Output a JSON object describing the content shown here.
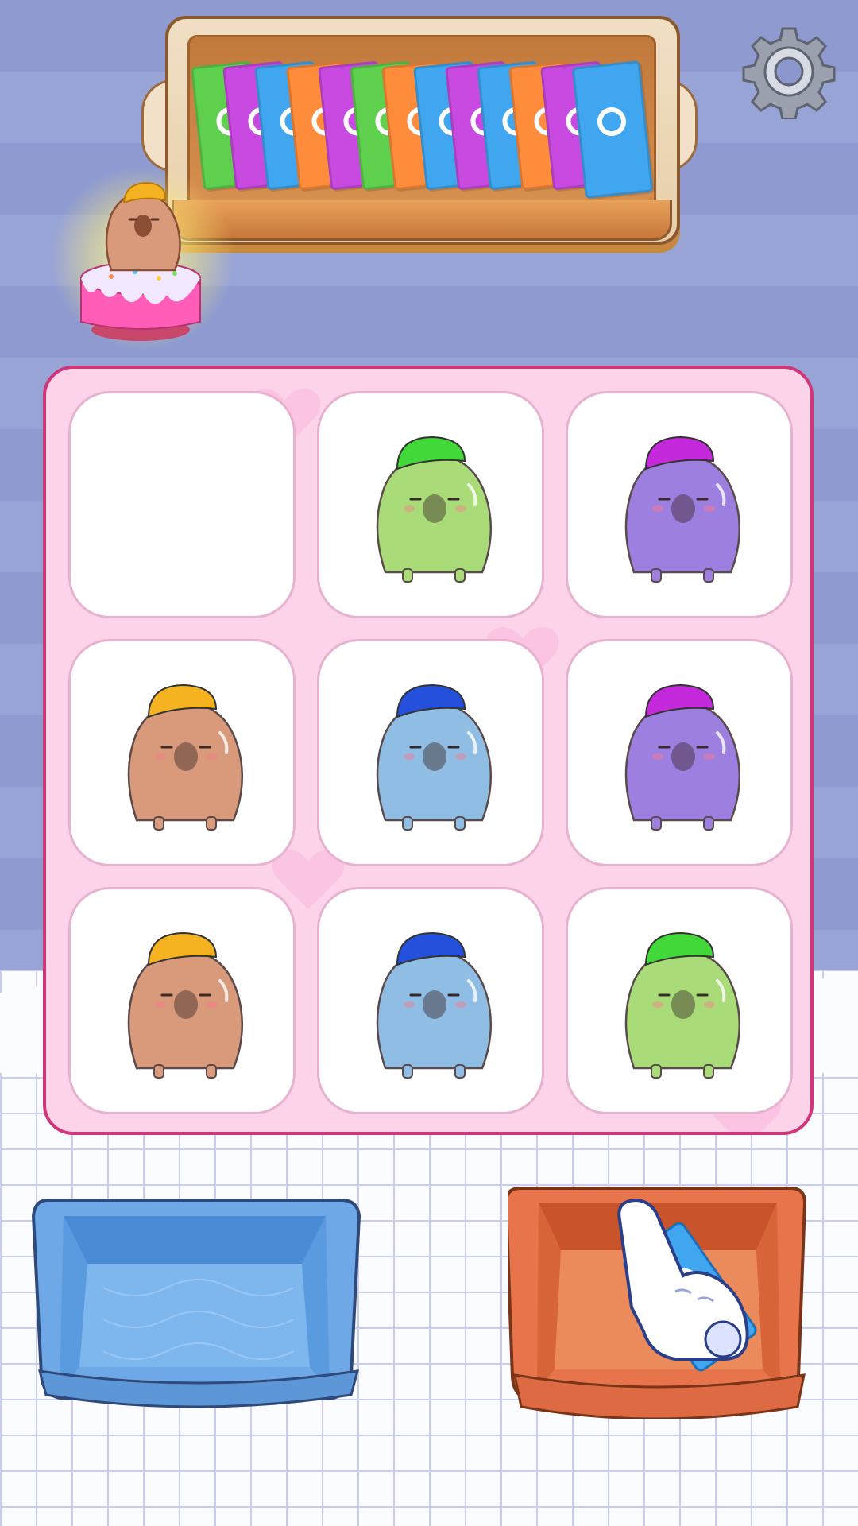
{
  "game": {
    "settings_icon": "gear-icon",
    "tray": {
      "cards": [
        {
          "color": "#5ed04e"
        },
        {
          "color": "#c84ae0"
        },
        {
          "color": "#3fa6ef"
        },
        {
          "color": "#ff8c3a"
        },
        {
          "color": "#c84ae0"
        },
        {
          "color": "#5ed04e"
        },
        {
          "color": "#ff8c3a"
        },
        {
          "color": "#3fa6ef"
        },
        {
          "color": "#c84ae0"
        },
        {
          "color": "#3fa6ef"
        },
        {
          "color": "#ff8c3a"
        },
        {
          "color": "#c84ae0"
        },
        {
          "color": "#3fa6ef"
        }
      ]
    },
    "reward": {
      "icon": "capybara-on-cake-icon",
      "hat_color": "#f5b321",
      "body_color": "#d89a7b"
    },
    "board": {
      "slots": [
        {
          "empty": true
        },
        {
          "body": "#a9dc78",
          "hat": "#42d83a",
          "name": "green-capybara"
        },
        {
          "body": "#9d7fe0",
          "hat": "#c429dc",
          "name": "purple-capybara"
        },
        {
          "body": "#d89a7b",
          "hat": "#f5b321",
          "name": "brown-capybara"
        },
        {
          "body": "#8fbde4",
          "hat": "#2450dc",
          "name": "blue-capybara"
        },
        {
          "body": "#9d7fe0",
          "hat": "#c429dc",
          "name": "purple-capybara"
        },
        {
          "body": "#d89a7b",
          "hat": "#f5b321",
          "name": "brown-capybara"
        },
        {
          "body": "#8fbde4",
          "hat": "#2450dc",
          "name": "blue-capybara"
        },
        {
          "body": "#a9dc78",
          "hat": "#42d83a",
          "name": "green-capybara"
        }
      ]
    },
    "boxes": {
      "left": {
        "color": "#6ea8e6",
        "icon": "blue-box-icon"
      },
      "right": {
        "color": "#e8744c",
        "icon": "red-box-icon",
        "contents": "blue-card"
      }
    },
    "tutorial_pointer": "pointing-hand-icon"
  }
}
